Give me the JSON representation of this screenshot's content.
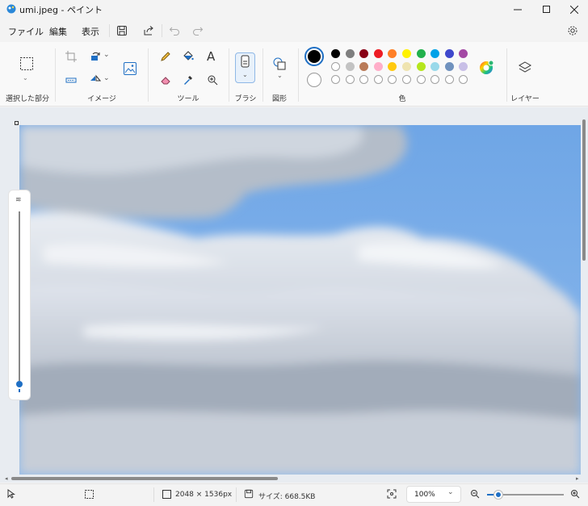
{
  "window": {
    "title": "umi.jpeg - ペイント"
  },
  "menu": {
    "file": "ファイル",
    "edit": "編集",
    "view": "表示"
  },
  "ribbon": {
    "groups": {
      "selection": "選択した部分",
      "image": "イメージ",
      "tools": "ツール",
      "brush": "ブラシ",
      "shapes": "図形",
      "colors": "色",
      "layers": "レイヤー"
    },
    "text_tool_glyph": "A",
    "palette_row1": [
      "#000000",
      "#7f7f7f",
      "#880015",
      "#ed1c24",
      "#ff7f27",
      "#fff200",
      "#22b14c",
      "#00a2e8",
      "#3f48cc",
      "#a349a4"
    ],
    "palette_row2": [
      "#ffffff",
      "#c3c3c3",
      "#b97a57",
      "#ffaec9",
      "#ffc90e",
      "#efe4b0",
      "#b5e61d",
      "#99d9ea",
      "#7092be",
      "#c8bfe7"
    ],
    "palette_row3_count": 10,
    "primary_color": "#000000",
    "secondary_color": "#ffffff"
  },
  "status": {
    "dimensions": "2048 × 1536px",
    "size": "サイズ: 668.5KB",
    "zoom": "100%",
    "zoom_level_fraction": 0.15
  }
}
